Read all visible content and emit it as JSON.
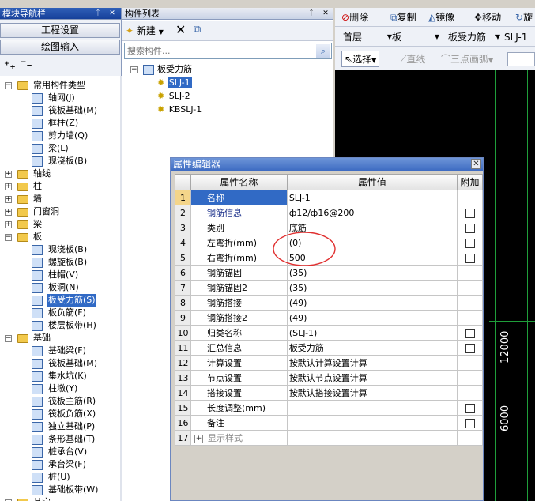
{
  "left_panel": {
    "title": "模块导航栏",
    "buttons": [
      "工程设置",
      "绘图输入"
    ],
    "tree": [
      {
        "label": "常用构件类型",
        "level": 0,
        "expanded": true
      },
      {
        "label": "轴网(J)",
        "level": 1
      },
      {
        "label": "筏板基础(M)",
        "level": 1
      },
      {
        "label": "框柱(Z)",
        "level": 1
      },
      {
        "label": "剪力墙(Q)",
        "level": 1
      },
      {
        "label": "梁(L)",
        "level": 1
      },
      {
        "label": "现浇板(B)",
        "level": 1
      },
      {
        "label": "轴线",
        "level": 0,
        "expanded": false
      },
      {
        "label": "柱",
        "level": 0,
        "expanded": false
      },
      {
        "label": "墙",
        "level": 0,
        "expanded": false
      },
      {
        "label": "门窗洞",
        "level": 0,
        "expanded": false
      },
      {
        "label": "梁",
        "level": 0,
        "expanded": false
      },
      {
        "label": "板",
        "level": 0,
        "expanded": true
      },
      {
        "label": "现浇板(B)",
        "level": 1
      },
      {
        "label": "螺旋板(B)",
        "level": 1
      },
      {
        "label": "柱帽(V)",
        "level": 1
      },
      {
        "label": "板洞(N)",
        "level": 1
      },
      {
        "label": "板受力筋(S)",
        "level": 1,
        "selected": true
      },
      {
        "label": "板负筋(F)",
        "level": 1
      },
      {
        "label": "楼层板带(H)",
        "level": 1
      },
      {
        "label": "基础",
        "level": 0,
        "expanded": true
      },
      {
        "label": "基础梁(F)",
        "level": 1
      },
      {
        "label": "筏板基础(M)",
        "level": 1
      },
      {
        "label": "集水坑(K)",
        "level": 1
      },
      {
        "label": "柱墩(Y)",
        "level": 1
      },
      {
        "label": "筏板主筋(R)",
        "level": 1
      },
      {
        "label": "筏板负筋(X)",
        "level": 1
      },
      {
        "label": "独立基础(P)",
        "level": 1
      },
      {
        "label": "条形基础(T)",
        "level": 1
      },
      {
        "label": "桩承台(V)",
        "level": 1
      },
      {
        "label": "承台梁(F)",
        "level": 1
      },
      {
        "label": "桩(U)",
        "level": 1
      },
      {
        "label": "基础板带(W)",
        "level": 1
      },
      {
        "label": "其它",
        "level": 0,
        "expanded": true
      }
    ]
  },
  "component_list": {
    "title": "构件列表",
    "new_label": "新建",
    "search_placeholder": "搜索构件...",
    "root": "板受力筋",
    "items": [
      "SLJ-1",
      "SLJ-2",
      "KBSLJ-1"
    ],
    "selected": "SLJ-1"
  },
  "toolbar": {
    "delete": "删除",
    "copy": "复制",
    "mirror": "镜像",
    "move": "移动",
    "rotate": "旋",
    "select": "选择",
    "line": "直线",
    "arc": "三点画弧"
  },
  "selectors": {
    "floor": "首层",
    "category": "板",
    "type": "板受力筋",
    "item": "SLJ-1"
  },
  "dialog": {
    "title": "属性编辑器",
    "col_name": "属性名称",
    "col_value": "属性值",
    "col_extra": "附加",
    "rows": [
      {
        "no": "1",
        "name": "名称",
        "value": "SLJ-1",
        "check": false,
        "blue": true
      },
      {
        "no": "2",
        "name": "钢筋信息",
        "value": "ф12/ф16@200",
        "check": true,
        "blue": true
      },
      {
        "no": "3",
        "name": "类别",
        "value": "底筋",
        "check": true
      },
      {
        "no": "4",
        "name": "左弯折(mm)",
        "value": "(0)",
        "check": true
      },
      {
        "no": "5",
        "name": "右弯折(mm)",
        "value": "500",
        "check": true
      },
      {
        "no": "6",
        "name": "钢筋锚固",
        "value": "(35)",
        "check": false
      },
      {
        "no": "7",
        "name": "钢筋锚固2",
        "value": "(35)",
        "check": false
      },
      {
        "no": "8",
        "name": "钢筋搭接",
        "value": "(49)",
        "check": false
      },
      {
        "no": "9",
        "name": "钢筋搭接2",
        "value": "(49)",
        "check": false
      },
      {
        "no": "10",
        "name": "归类名称",
        "value": "(SLJ-1)",
        "check": true
      },
      {
        "no": "11",
        "name": "汇总信息",
        "value": "板受力筋",
        "check": true
      },
      {
        "no": "12",
        "name": "计算设置",
        "value": "按默认计算设置计算",
        "check": false
      },
      {
        "no": "13",
        "name": "节点设置",
        "value": "按默认节点设置计算",
        "check": false
      },
      {
        "no": "14",
        "name": "搭接设置",
        "value": "按默认搭接设置计算",
        "check": false
      },
      {
        "no": "15",
        "name": "长度调整(mm)",
        "value": "",
        "check": true
      },
      {
        "no": "16",
        "name": "备注",
        "value": "",
        "check": true
      },
      {
        "no": "17",
        "name": "显示样式",
        "value": "",
        "check": false,
        "expandable": true
      }
    ]
  },
  "canvas": {
    "dim1": "12000",
    "dim2": "6000"
  },
  "colors": {
    "selection": "#316ac5",
    "highlight_circle": "#e03030",
    "canvas_bg": "#000000",
    "grid_line": "#1f9e3a"
  }
}
